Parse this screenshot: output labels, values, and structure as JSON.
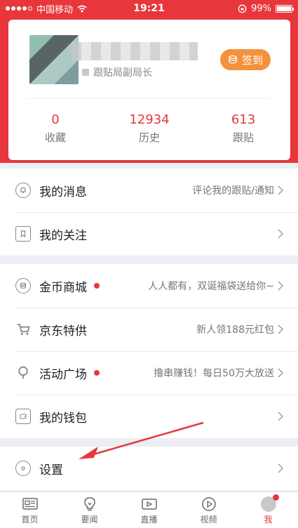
{
  "status_bar": {
    "carrier": "中国移动",
    "time": "19:21",
    "battery": "99%",
    "battery_level": 0.99
  },
  "profile": {
    "rank": "跟贴局副局长",
    "checkin_label": "签到",
    "stats": [
      {
        "value": "0",
        "label": "收藏"
      },
      {
        "value": "12934",
        "label": "历史"
      },
      {
        "value": "613",
        "label": "跟贴"
      }
    ]
  },
  "menu": {
    "messages": {
      "title": "我的消息",
      "subtitle": "评论我的跟贴/通知",
      "icon": "bell-icon"
    },
    "follows": {
      "title": "我的关注",
      "icon": "bookmark-icon"
    },
    "coin_mall": {
      "title": "金币商城",
      "subtitle": "人人都有，双诞福袋送给你~",
      "icon": "coins-icon"
    },
    "jd": {
      "title": "京东特供",
      "subtitle": "新人领188元红包",
      "icon": "cart-icon"
    },
    "events": {
      "title": "活动广场",
      "subtitle": "撸串赚钱！每日50万大放送",
      "icon": "balloon-icon"
    },
    "wallet": {
      "title": "我的钱包",
      "icon": "wallet-icon"
    },
    "settings": {
      "title": "设置",
      "icon": "gear-icon"
    }
  },
  "tabbar": {
    "items": [
      {
        "label": "首页",
        "icon": "newspaper-icon"
      },
      {
        "label": "要闻",
        "icon": "lightbulb-icon"
      },
      {
        "label": "直播",
        "icon": "video-camera-icon"
      },
      {
        "label": "视频",
        "icon": "play-icon"
      },
      {
        "label": "我",
        "icon": "avatar-icon"
      }
    ],
    "active_index": 4
  },
  "colors": {
    "brand_red": "#e8373c",
    "checkin_orange": "#f4913c",
    "background": "#ebeef2"
  }
}
